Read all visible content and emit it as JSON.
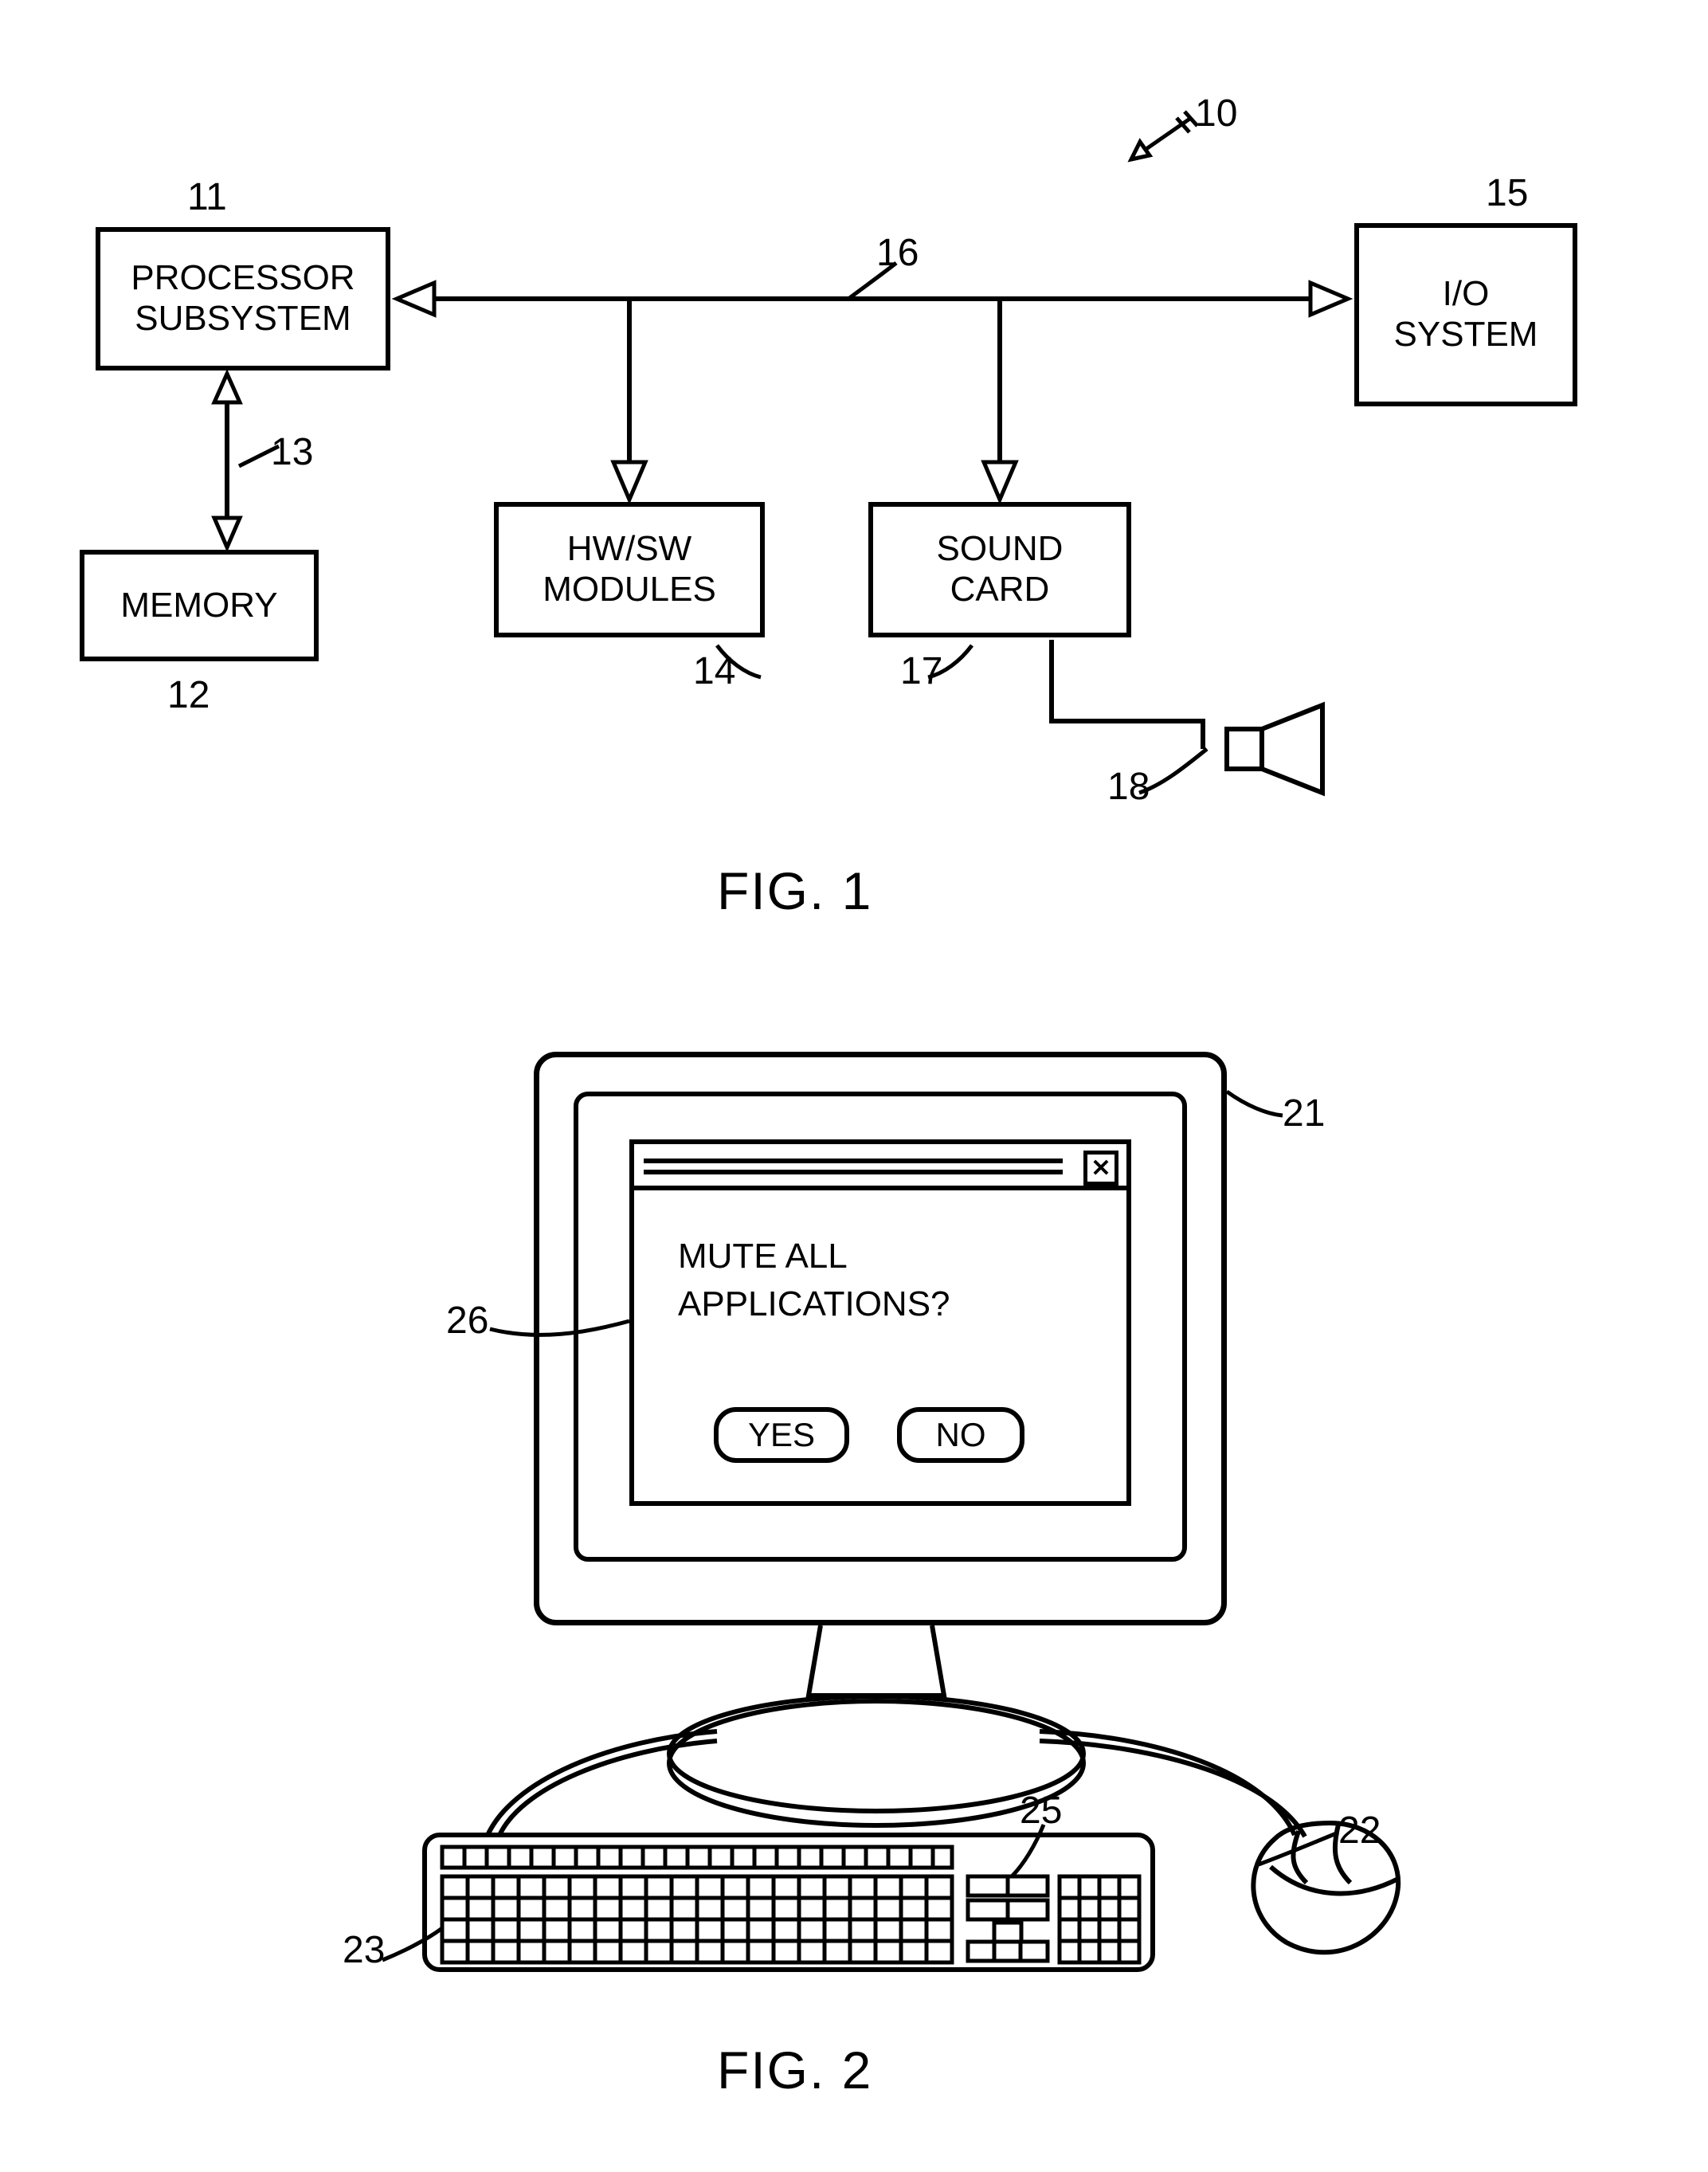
{
  "fig1": {
    "caption": "FIG. 1",
    "ref_overall": "10",
    "ref_processor": "11",
    "ref_memory": "12",
    "ref_memlink": "13",
    "ref_hwsw": "14",
    "ref_io": "15",
    "ref_bus": "16",
    "ref_sound": "17",
    "ref_speaker": "18",
    "processor": "PROCESSOR\nSUBSYSTEM",
    "memory": "MEMORY",
    "hwsw": "HW/SW\nMODULES",
    "sound": "SOUND\nCARD",
    "io": "I/O\nSYSTEM"
  },
  "fig2": {
    "caption": "FIG. 2",
    "ref_monitor": "21",
    "ref_mouse": "22",
    "ref_keyboard": "23",
    "ref_keyside": "25",
    "ref_window": "26",
    "dialog_l1": "MUTE ALL",
    "dialog_l2": "APPLICATIONS?",
    "yes": "YES",
    "no": "NO",
    "close_glyph": "✕"
  }
}
